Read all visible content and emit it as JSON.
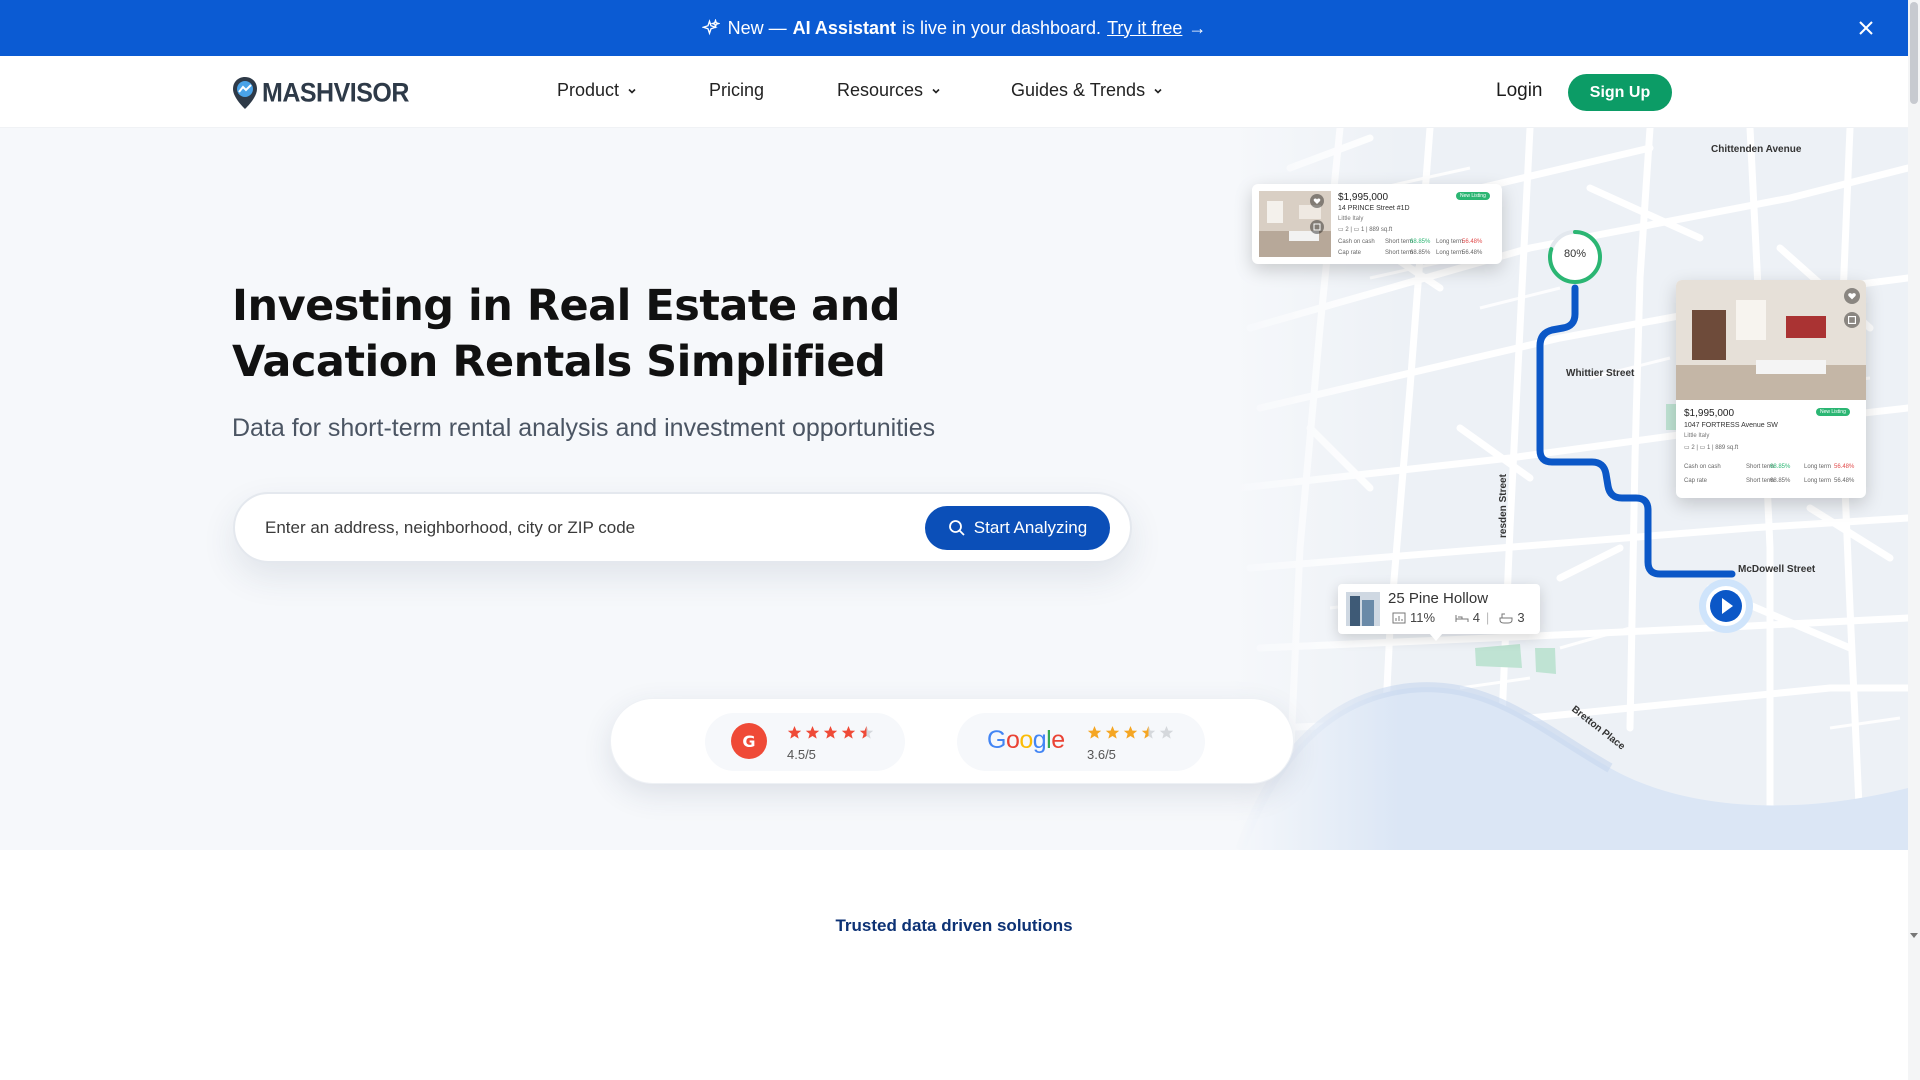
{
  "announcement": {
    "prefix": "New —",
    "highlight": "AI Assistant",
    "suffix": "is live in your dashboard.",
    "link": "Try it free",
    "arrow": "→"
  },
  "header": {
    "brand": "MASHVISOR",
    "nav": [
      {
        "label": "Product",
        "has_dropdown": true
      },
      {
        "label": "Pricing",
        "has_dropdown": false
      },
      {
        "label": "Resources",
        "has_dropdown": true
      },
      {
        "label": "Guides & Trends",
        "has_dropdown": true
      }
    ],
    "login": "Login",
    "signup": "Sign Up"
  },
  "hero": {
    "title": "Investing in Real Estate and Vacation Rentals Simplified",
    "subtitle": "Data for short-term rental analysis and investment opportunities",
    "search_placeholder": "Enter an address, neighborhood, city or ZIP code",
    "search_button": "Start Analyzing"
  },
  "ratings": {
    "g2": {
      "score": "4.5/5",
      "stars": 4.5
    },
    "google": {
      "score": "3.6/5",
      "stars": 3.5
    }
  },
  "map": {
    "streets": {
      "chittenden": "Chittenden Avenue",
      "whittier": "Whittier Street",
      "dresden": "resden Street",
      "mcdowell": "McDowell Street",
      "bretton": "Bretton Place"
    },
    "progress_label": "80%",
    "progress_value": 0.8,
    "listing1": {
      "price": "$1,995,000",
      "address": "14 PRINCE Street #1D",
      "area": "Little Italy",
      "badge": "New Listing",
      "beds": "2",
      "baths": "1",
      "sqft": "889",
      "sqft_unit": "sq.ft",
      "row1_label": "Cash on cash",
      "row2_label": "Cap rate",
      "short_term": "Short term",
      "long_term": "Long term",
      "row1_short": "68.85%",
      "row1_long": "56.48%",
      "row2_short": "68.85%",
      "row2_long": "56.48%"
    },
    "listing2": {
      "price": "$1,995,000",
      "address": "1047 FORTRESS Avenue SW",
      "area": "Little Italy",
      "badge": "New Listing",
      "beds": "2",
      "baths": "1",
      "sqft": "889",
      "sqft_unit": "sq.ft",
      "row1_label": "Cash on cash",
      "row2_label": "Cap rate",
      "short_term": "Short term",
      "long_term": "Long term",
      "row1_short": "68.85%",
      "row1_long": "56.48%",
      "row2_short": "68.85%",
      "row2_long": "56.48%"
    },
    "pin": {
      "title": "25 Pine Hollow",
      "rate": "11%",
      "beds": "4",
      "baths": "3"
    }
  },
  "trusted": "Trusted data driven solutions",
  "colors": {
    "announce_bg": "#0b5bd3",
    "primary_blue": "#0b4fb8",
    "signup_green": "#0c9c66",
    "route_blue": "#0b57c7",
    "trusted_text": "#0d3275"
  },
  "icons": {
    "sparkle": "sparkle-icon",
    "close": "close-icon",
    "chevron": "chevron-down-icon",
    "search": "search-icon",
    "star": "star-icon",
    "play": "play-icon"
  }
}
